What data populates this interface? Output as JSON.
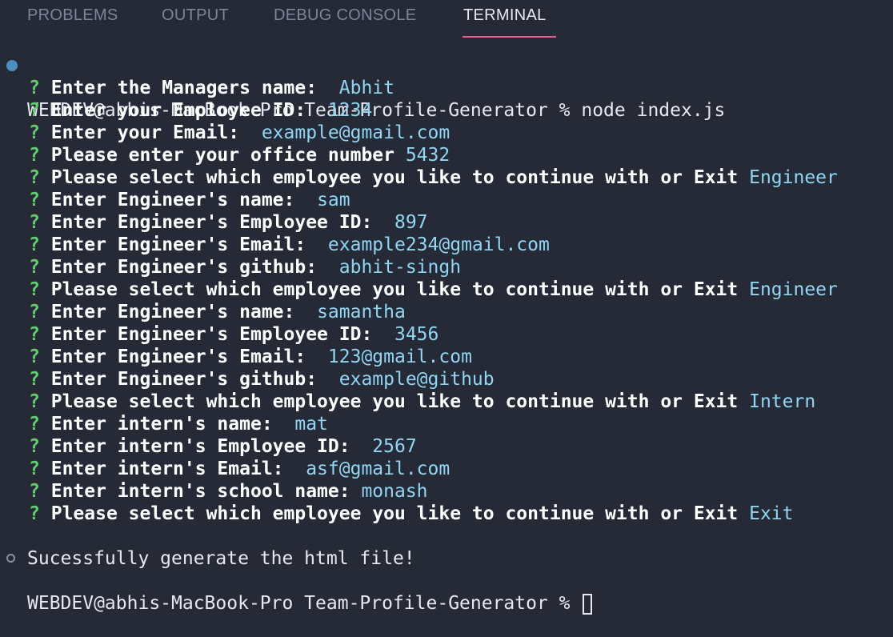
{
  "panel": {
    "tabs": [
      {
        "label": "PROBLEMS"
      },
      {
        "label": "OUTPUT"
      },
      {
        "label": "DEBUG CONSOLE"
      },
      {
        "label": "TERMINAL"
      }
    ],
    "active_tab": "TERMINAL"
  },
  "terminal": {
    "prompt1": "WEBDEV@abhis-MacBook-Pro Team-Profile-Generator % node index.js",
    "qmark": "?",
    "questions": [
      {
        "q": "Enter the Managers name: ",
        "a": " Abhit"
      },
      {
        "q": "Enter your Employee ID: ",
        "a": " 1234"
      },
      {
        "q": "Enter your Email: ",
        "a": " example@gmail.com"
      },
      {
        "q": "Please enter your office number",
        "a": " 5432"
      },
      {
        "q": "Please select which employee you like to continue with or Exit",
        "a": " Engineer"
      },
      {
        "q": "Enter Engineer's name: ",
        "a": " sam"
      },
      {
        "q": "Enter Engineer's Employee ID: ",
        "a": " 897"
      },
      {
        "q": "Enter Engineer's Email: ",
        "a": " example234@gmail.com"
      },
      {
        "q": "Enter Engineer's github: ",
        "a": " abhit-singh"
      },
      {
        "q": "Please select which employee you like to continue with or Exit",
        "a": " Engineer"
      },
      {
        "q": "Enter Engineer's name: ",
        "a": " samantha"
      },
      {
        "q": "Enter Engineer's Employee ID: ",
        "a": " 3456"
      },
      {
        "q": "Enter Engineer's Email: ",
        "a": " 123@gmail.com"
      },
      {
        "q": "Enter Engineer's github: ",
        "a": " example@github"
      },
      {
        "q": "Please select which employee you like to continue with or Exit",
        "a": " Intern"
      },
      {
        "q": "Enter intern's name: ",
        "a": " mat"
      },
      {
        "q": "Enter intern's Employee ID: ",
        "a": " 2567"
      },
      {
        "q": "Enter intern's Email: ",
        "a": " asf@gmail.com"
      },
      {
        "q": "Enter intern's school name:",
        "a": " monash"
      },
      {
        "q": "Please select which employee you like to continue with or Exit",
        "a": " Exit"
      }
    ],
    "success_message": "Sucessfully generate the html file!",
    "prompt2": "WEBDEV@abhis-MacBook-Pro Team-Profile-Generator % "
  }
}
